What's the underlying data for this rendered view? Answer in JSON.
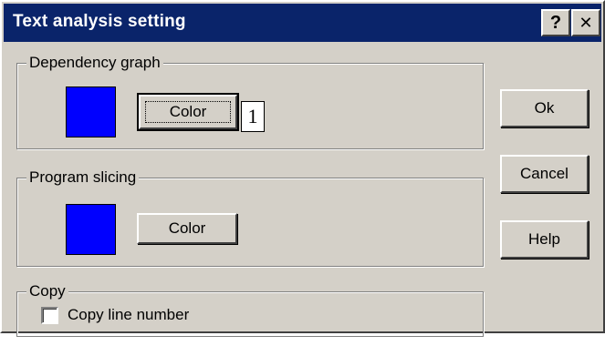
{
  "window": {
    "title": "Text analysis setting",
    "help_button": "?",
    "close_button": "✕"
  },
  "dependency_graph": {
    "label": "Dependency graph",
    "swatch_color": "#0000ff",
    "color_button": "Color",
    "marker": "1"
  },
  "program_slicing": {
    "label": "Program slicing",
    "swatch_color": "#0000ff",
    "color_button": "Color"
  },
  "copy": {
    "label": "Copy",
    "checkbox_label": "Copy line number",
    "checked": false
  },
  "actions": {
    "ok": "Ok",
    "cancel": "Cancel",
    "help": "Help"
  }
}
